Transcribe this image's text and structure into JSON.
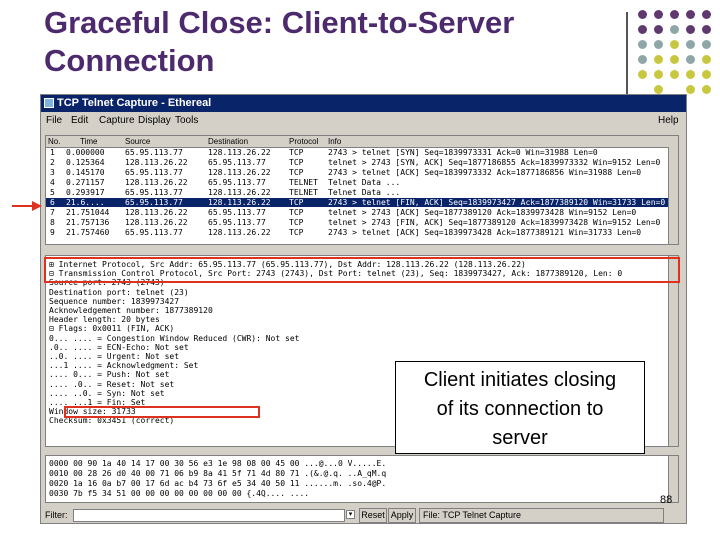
{
  "slide": {
    "title_line1": "Graceful Close:  Client-to-Server",
    "title_line2": "Connection",
    "page_number": "88",
    "callout": {
      "line1": "Client initiates closing",
      "line2": "of its connection to",
      "line3": "server"
    },
    "colors": {
      "title": "#4d2a6e",
      "highlight": "#e03020",
      "dot_purple": "#5e3a6e",
      "dot_gray": "#8fa6a6",
      "dot_yellow": "#c8c840"
    }
  },
  "window": {
    "title": "TCP Telnet Capture - Ethereal",
    "menu": [
      "File",
      "Edit",
      "Capture",
      "Display",
      "Tools",
      "Help"
    ],
    "columns": [
      "No.",
      "Time",
      "Source",
      "Destination",
      "Protocol",
      "Info"
    ],
    "packets": [
      {
        "no": "1",
        "time": "0.000000",
        "src": "65.95.113.77",
        "dst": "128.113.26.22",
        "proto": "TCP",
        "info": "2743 > telnet [SYN] Seq=1839973331 Ack=0 Win=31988 Len=0"
      },
      {
        "no": "2",
        "time": "0.125364",
        "src": "128.113.26.22",
        "dst": "65.95.113.77",
        "proto": "TCP",
        "info": "telnet > 2743 [SYN, ACK] Seq=1877186855 Ack=1839973332 Win=9152 Len=0"
      },
      {
        "no": "3",
        "time": "0.145170",
        "src": "65.95.113.77",
        "dst": "128.113.26.22",
        "proto": "TCP",
        "info": "2743 > telnet [ACK] Seq=1839973332 Ack=1877186856 Win=31988 Len=0"
      },
      {
        "no": "4",
        "time": "0.271157",
        "src": "128.113.26.22",
        "dst": "65.95.113.77",
        "proto": "TELNET",
        "info": "Telnet Data ..."
      },
      {
        "no": "5",
        "time": "0.293917",
        "src": "65.95.113.77",
        "dst": "128.113.26.22",
        "proto": "TELNET",
        "info": "Telnet Data ..."
      },
      {
        "no": "6",
        "time": "21.6....",
        "src": "65.95.113.77",
        "dst": "128.113.26.22",
        "proto": "TCP",
        "info": "2743 > telnet [FIN, ACK] Seq=1839973427 Ack=1877389120 Win=31733 Len=0"
      },
      {
        "no": "7",
        "time": "21.751044",
        "src": "128.113.26.22",
        "dst": "65.95.113.77",
        "proto": "TCP",
        "info": "telnet > 2743 [ACK] Seq=1877389120 Ack=1839973428 Win=9152 Len=0"
      },
      {
        "no": "8",
        "time": "21.757136",
        "src": "128.113.26.22",
        "dst": "65.95.113.77",
        "proto": "TCP",
        "info": "telnet > 2743 [FIN, ACK] Seq=1877389120 Ack=1839973428 Win=9152 Len=0"
      },
      {
        "no": "9",
        "time": "21.757460",
        "src": "65.95.113.77",
        "dst": "128.113.26.22",
        "proto": "TCP",
        "info": "2743 > telnet [ACK] Seq=1839973428 Ack=1877389121 Win=31733 Len=0"
      }
    ],
    "tree": [
      "⊞ Internet Protocol, Src Addr: 65.95.113.77 (65.95.113.77), Dst Addr: 128.113.26.22 (128.113.26.22)",
      "⊟ Transmission Control Protocol, Src Port: 2743 (2743), Dst Port: telnet (23), Seq: 1839973427, Ack: 1877389120, Len: 0",
      "    Source port: 2743 (2743)",
      "    Destination port: telnet (23)",
      "    Sequence number: 1839973427",
      "    Acknowledgement number: 1877389120",
      "    Header length: 20 bytes",
      "  ⊟ Flags: 0x0011 (FIN, ACK)",
      "      0... .... = Congestion Window Reduced (CWR): Not set",
      "      .0.. .... = ECN-Echo: Not set",
      "      ..0. .... = Urgent: Not set",
      "      ...1 .... = Acknowledgment: Set",
      "      .... 0... = Push: Not set",
      "      .... .0.. = Reset: Not set",
      "      .... ..0. = Syn: Not set",
      "      .... ...1 = Fin: Set",
      "    Window size: 31733",
      "    Checksum: 0x3451 (correct)"
    ],
    "hex": [
      "0000  00 90 1a 40 14 17 00 30  56 e3 1e 98 08 00 45 00   ...@...0 V.....E.",
      "0010  00 28 26 d0 40 00 71 06  b9 8a 41 5f 71 4d 80 71   .(&.@.q. ..A_qM.q",
      "0020  1a 16 0a b7 00 17 6d ac  b4 73 6f e5 34 40 50 11   ......m. .so.4@P.",
      "0030  7b f5 34 51 00 00 00 00  00 00 00 00               {.4Q.... ...."
    ],
    "status": {
      "filter_label": "Filter:",
      "filter_value": "",
      "reset_label": "Reset",
      "apply_label": "Apply",
      "file_info": "File: TCP Telnet Capture"
    }
  }
}
